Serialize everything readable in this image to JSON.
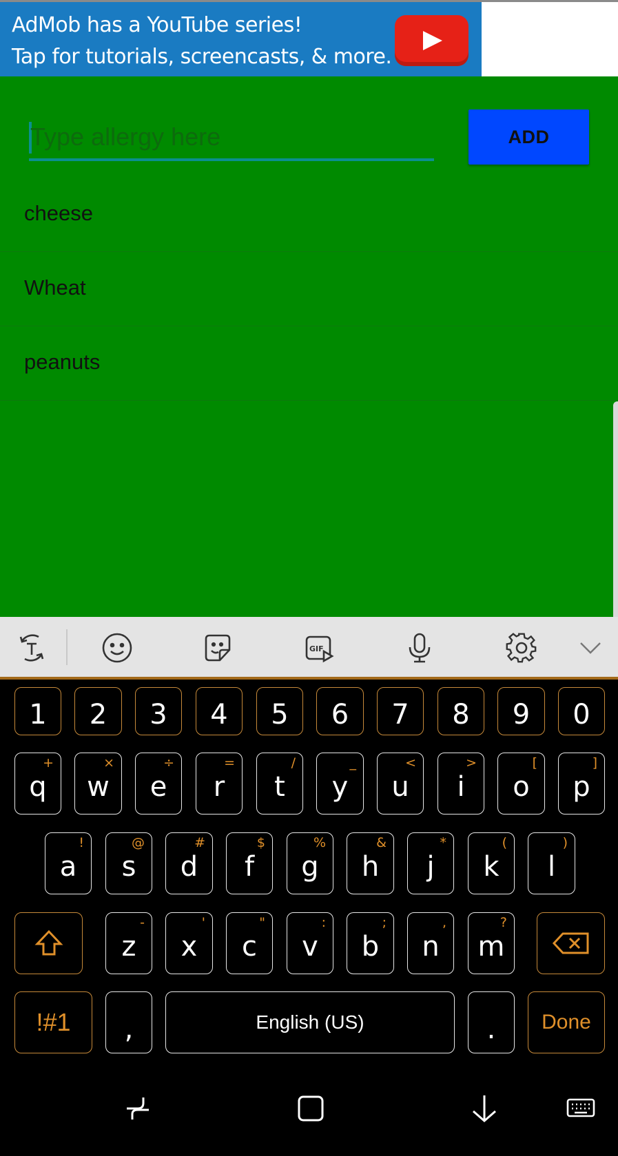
{
  "ad": {
    "line1": "AdMob has a YouTube series!",
    "line2": "Tap for tutorials, screencasts, & more.",
    "icon": "youtube-play-icon"
  },
  "form": {
    "placeholder": "Type allergy here",
    "value": "",
    "add_label": "ADD"
  },
  "allergies": [
    "cheese",
    "Wheat",
    "peanuts"
  ],
  "toolbar": {
    "icons": [
      "text-mode-icon",
      "emoji-icon",
      "sticker-icon",
      "gif-icon",
      "microphone-icon",
      "settings-gear-icon",
      "chevron-down-icon"
    ]
  },
  "keyboard": {
    "numbers": [
      "1",
      "2",
      "3",
      "4",
      "5",
      "6",
      "7",
      "8",
      "9",
      "0"
    ],
    "row1": [
      {
        "k": "q",
        "s": "+"
      },
      {
        "k": "w",
        "s": "×"
      },
      {
        "k": "e",
        "s": "÷"
      },
      {
        "k": "r",
        "s": "="
      },
      {
        "k": "t",
        "s": "/"
      },
      {
        "k": "y",
        "s": "_"
      },
      {
        "k": "u",
        "s": "<"
      },
      {
        "k": "i",
        "s": ">"
      },
      {
        "k": "o",
        "s": "["
      },
      {
        "k": "p",
        "s": "]"
      }
    ],
    "row2": [
      {
        "k": "a",
        "s": "!"
      },
      {
        "k": "s",
        "s": "@"
      },
      {
        "k": "d",
        "s": "#"
      },
      {
        "k": "f",
        "s": "$"
      },
      {
        "k": "g",
        "s": "%"
      },
      {
        "k": "h",
        "s": "&"
      },
      {
        "k": "j",
        "s": "*"
      },
      {
        "k": "k",
        "s": "("
      },
      {
        "k": "l",
        "s": ")"
      }
    ],
    "row3": [
      {
        "k": "z",
        "s": "-"
      },
      {
        "k": "x",
        "s": "'"
      },
      {
        "k": "c",
        "s": "\""
      },
      {
        "k": "v",
        "s": ":"
      },
      {
        "k": "b",
        "s": ";"
      },
      {
        "k": "n",
        "s": ","
      },
      {
        "k": "m",
        "s": "?"
      }
    ],
    "symbols_label": "!#1",
    "comma": ",",
    "space_label": "English (US)",
    "period": ".",
    "done_label": "Done"
  },
  "colors": {
    "app_bg": "#008a00",
    "ad_bg": "#1a7bc2",
    "add_button": "#0047ff",
    "accent": "#e0902a"
  },
  "nav": {
    "icons": [
      "recents-icon",
      "home-icon",
      "back-icon",
      "keyboard-switch-icon"
    ]
  }
}
